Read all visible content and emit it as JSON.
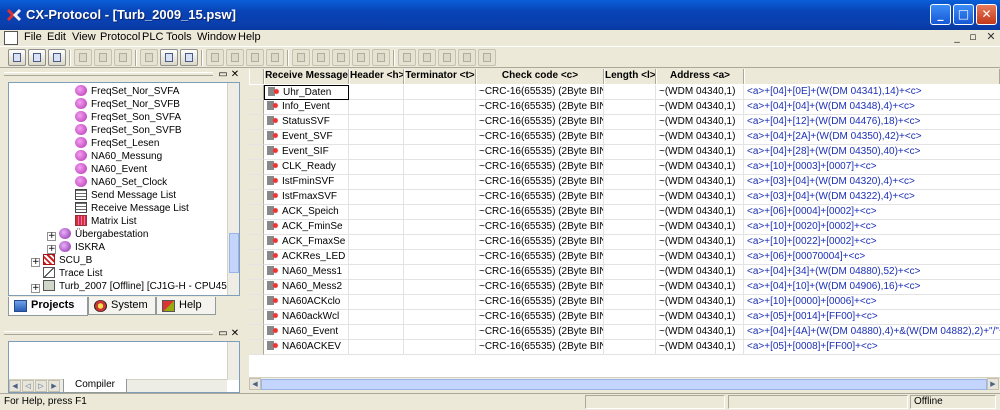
{
  "window": {
    "title": "CX-Protocol - [Turb_2009_15.psw]"
  },
  "menu": [
    "File",
    "Edit",
    "View",
    "Protocol",
    "PLC",
    "Tools",
    "Window",
    "Help"
  ],
  "tree": {
    "items": [
      {
        "label": "FreqSet_Nor_SVFA",
        "icon": "function-icon",
        "indent": 66
      },
      {
        "label": "FreqSet_Nor_SVFB",
        "icon": "function-icon",
        "indent": 66
      },
      {
        "label": "FreqSet_Son_SVFA",
        "icon": "function-icon",
        "indent": 66
      },
      {
        "label": "FreqSet_Son_SVFB",
        "icon": "function-icon",
        "indent": 66
      },
      {
        "label": "FreqSet_Lesen",
        "icon": "function-icon",
        "indent": 66
      },
      {
        "label": "NA60_Messung",
        "icon": "function-icon",
        "indent": 66
      },
      {
        "label": "NA60_Event",
        "icon": "function-icon",
        "indent": 66
      },
      {
        "label": "NA60_Set_Clock",
        "icon": "function-icon",
        "indent": 66
      },
      {
        "label": "Send Message List",
        "icon": "list-icon",
        "indent": 66
      },
      {
        "label": "Receive Message List",
        "icon": "list-icon",
        "indent": 66
      },
      {
        "label": "Matrix List",
        "icon": "matrix-icon",
        "indent": 66
      },
      {
        "label": "Übergabestation",
        "icon": "plc-icon",
        "indent": 40,
        "expander": "+"
      },
      {
        "label": "ISKRA",
        "icon": "plc-icon",
        "indent": 40,
        "expander": "+"
      },
      {
        "label": "SCU_B",
        "icon": "scu-icon",
        "indent": 22,
        "expander": "+"
      },
      {
        "label": "Trace List",
        "icon": "trace-icon",
        "indent": 22
      },
      {
        "label": "Turb_2007 [Offline] [CJ1G-H - CPU45]",
        "icon": "pc-icon",
        "indent": 22,
        "expander": "+"
      }
    ]
  },
  "tabs": [
    {
      "label": "Projects",
      "active": true
    },
    {
      "label": "System",
      "active": false
    },
    {
      "label": "Help",
      "active": false
    }
  ],
  "output": {
    "tab": "Compiler"
  },
  "grid": {
    "columns": [
      "Receive Message",
      "Header <h>",
      "Terminator <t>",
      "Check code <c>",
      "Length <l>",
      "Address <a>",
      ""
    ],
    "rows": [
      {
        "message": "Uhr_Daten",
        "check": "~CRC-16(65535) (2Byte BIN)",
        "address": "~(WDM 04340,1)",
        "data": "<a>+[04]+[0E]+(W(DM 04341),14)+<c>"
      },
      {
        "message": "Info_Event",
        "check": "~CRC-16(65535) (2Byte BIN)",
        "address": "~(WDM 04340,1)",
        "data": "<a>+[04]+[04]+(W(DM 04348),4)+<c>"
      },
      {
        "message": "StatusSVF",
        "check": "~CRC-16(65535) (2Byte BIN)",
        "address": "~(WDM 04340,1)",
        "data": "<a>+[04]+[12]+(W(DM 04476),18)+<c>"
      },
      {
        "message": "Event_SVF",
        "check": "~CRC-16(65535) (2Byte BIN)",
        "address": "~(WDM 04340,1)",
        "data": "<a>+[04]+[2A]+(W(DM 04350),42)+<c>"
      },
      {
        "message": "Event_SIF",
        "check": "~CRC-16(65535) (2Byte BIN)",
        "address": "~(WDM 04340,1)",
        "data": "<a>+[04]+[28]+(W(DM 04350),40)+<c>"
      },
      {
        "message": "CLK_Ready",
        "check": "~CRC-16(65535) (2Byte BIN)",
        "address": "~(WDM 04340,1)",
        "data": "<a>+[10]+[0003]+[0007]+<c>"
      },
      {
        "message": "IstFminSVF",
        "check": "~CRC-16(65535) (2Byte BIN)",
        "address": "~(WDM 04340,1)",
        "data": "<a>+[03]+[04]+(W(DM 04320),4)+<c>"
      },
      {
        "message": "IstFmaxSVF",
        "check": "~CRC-16(65535) (2Byte BIN)",
        "address": "~(WDM 04340,1)",
        "data": "<a>+[03]+[04]+(W(DM 04322),4)+<c>"
      },
      {
        "message": "ACK_Speich",
        "check": "~CRC-16(65535) (2Byte BIN)",
        "address": "~(WDM 04340,1)",
        "data": "<a>+[06]+[0004]+[0002]+<c>"
      },
      {
        "message": "ACK_FminSe",
        "check": "~CRC-16(65535) (2Byte BIN)",
        "address": "~(WDM 04340,1)",
        "data": "<a>+[10]+[0020]+[0002]+<c>"
      },
      {
        "message": "ACK_FmaxSe",
        "check": "~CRC-16(65535) (2Byte BIN)",
        "address": "~(WDM 04340,1)",
        "data": "<a>+[10]+[0022]+[0002]+<c>"
      },
      {
        "message": "ACKRes_LED",
        "check": "~CRC-16(65535) (2Byte BIN)",
        "address": "~(WDM 04340,1)",
        "data": "<a>+[06]+[00070004]+<c>"
      },
      {
        "message": "NA60_Mess1",
        "check": "~CRC-16(65535) (2Byte BIN)",
        "address": "~(WDM 04340,1)",
        "data": "<a>+[04]+[34]+(W(DM 04880),52)+<c>"
      },
      {
        "message": "NA60_Mess2",
        "check": "~CRC-16(65535) (2Byte BIN)",
        "address": "~(WDM 04340,1)",
        "data": "<a>+[04]+[10]+(W(DM 04906),16)+<c>"
      },
      {
        "message": "NA60ACKclo",
        "check": "~CRC-16(65535) (2Byte BIN)",
        "address": "~(WDM 04340,1)",
        "data": "<a>+[10]+[0000]+[0006]+<c>"
      },
      {
        "message": "NA60ackWcl",
        "check": "~CRC-16(65535) (2Byte BIN)",
        "address": "~(WDM 04340,1)",
        "data": "<a>+[05]+[0014]+[FF00]+<c>"
      },
      {
        "message": "NA60_Event",
        "check": "~CRC-16(65535) (2Byte BIN)",
        "address": "~(WDM 04340,1)",
        "data": "<a>+[04]+[4A]+(W(DM 04880),4)+&(W(DM 04882),2)+\"/\"+&(W("
      },
      {
        "message": "NA60ACKEV",
        "check": "~CRC-16(65535) (2Byte BIN)",
        "address": "~(WDM 04340,1)",
        "data": "<a>+[05]+[0008]+[FF00]+<c>"
      }
    ]
  },
  "status": {
    "help_text": "For Help, press F1",
    "mode": "Offline"
  }
}
